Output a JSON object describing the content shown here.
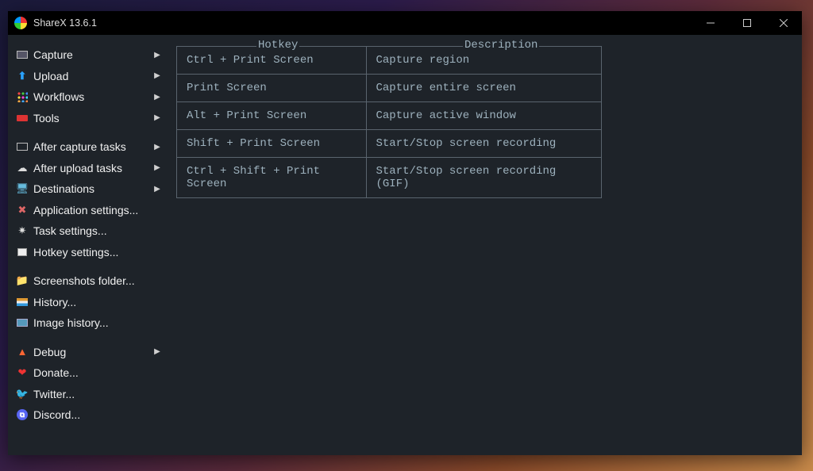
{
  "titlebar": {
    "title": "ShareX 13.6.1"
  },
  "sidebar": {
    "items": [
      {
        "icon": "capture-icon",
        "label": "Capture",
        "arrow": true
      },
      {
        "icon": "upload-icon",
        "label": "Upload",
        "arrow": true
      },
      {
        "icon": "workflows-icon",
        "label": "Workflows",
        "arrow": true
      },
      {
        "icon": "tools-icon",
        "label": "Tools",
        "arrow": true
      },
      {
        "sep": true
      },
      {
        "icon": "after-capture-icon",
        "label": "After capture tasks",
        "arrow": true
      },
      {
        "icon": "after-upload-icon",
        "label": "After upload tasks",
        "arrow": true
      },
      {
        "icon": "destinations-icon",
        "label": "Destinations",
        "arrow": true
      },
      {
        "icon": "app-settings-icon",
        "label": "Application settings...",
        "arrow": false
      },
      {
        "icon": "task-settings-icon",
        "label": "Task settings...",
        "arrow": false
      },
      {
        "icon": "hotkey-settings-icon",
        "label": "Hotkey settings...",
        "arrow": false
      },
      {
        "sep": true
      },
      {
        "icon": "folder-icon",
        "label": "Screenshots folder...",
        "arrow": false
      },
      {
        "icon": "history-icon",
        "label": "History...",
        "arrow": false
      },
      {
        "icon": "image-history-icon",
        "label": "Image history...",
        "arrow": false
      },
      {
        "sep": true
      },
      {
        "icon": "debug-icon",
        "label": "Debug",
        "arrow": true
      },
      {
        "icon": "donate-icon",
        "label": "Donate...",
        "arrow": false
      },
      {
        "icon": "twitter-icon",
        "label": "Twitter...",
        "arrow": false
      },
      {
        "icon": "discord-icon",
        "label": "Discord...",
        "arrow": false
      }
    ]
  },
  "hotkeys": {
    "header_hotkey": "Hotkey",
    "header_description": "Description",
    "rows": [
      {
        "key": "Ctrl + Print Screen",
        "desc": "Capture region"
      },
      {
        "key": "Print Screen",
        "desc": "Capture entire screen"
      },
      {
        "key": "Alt + Print Screen",
        "desc": "Capture active window"
      },
      {
        "key": "Shift + Print Screen",
        "desc": "Start/Stop screen recording"
      },
      {
        "key": "Ctrl + Shift + Print Screen",
        "desc": "Start/Stop screen recording (GIF)"
      }
    ]
  }
}
